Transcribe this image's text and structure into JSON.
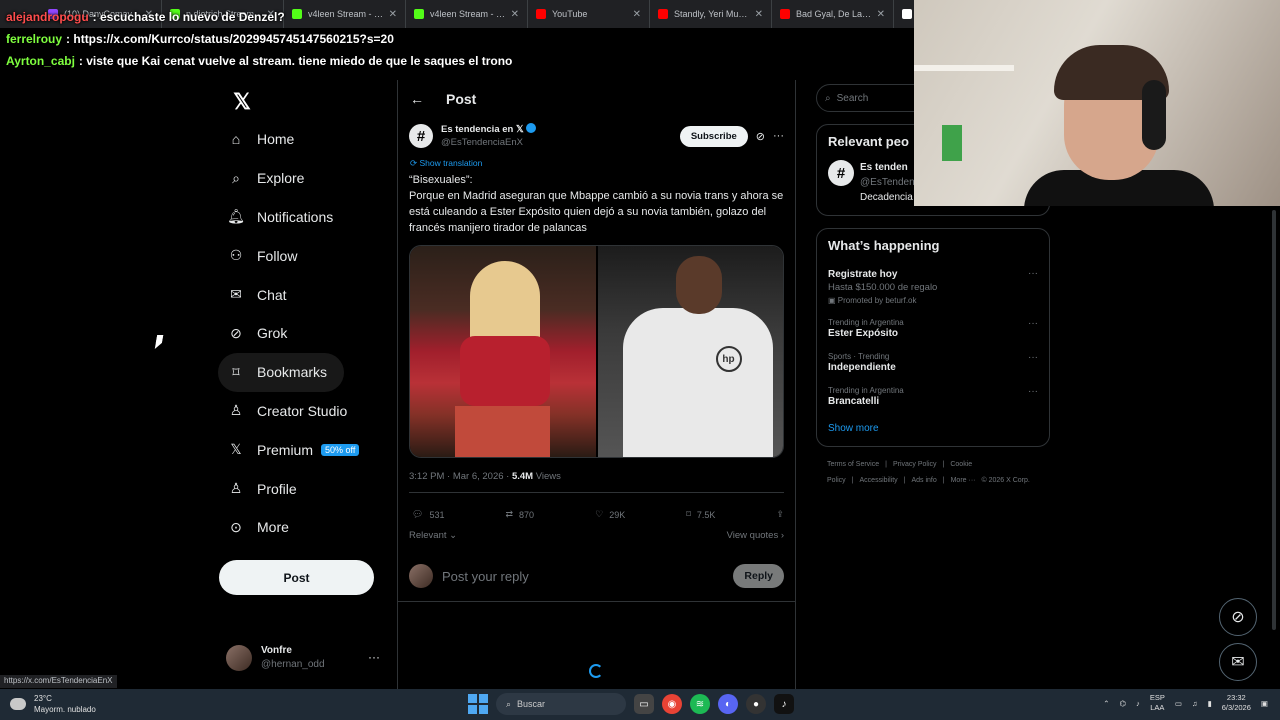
{
  "browser": {
    "tabs": [
      {
        "label": "(10) DanyComay",
        "color": "#9147ff"
      },
      {
        "label": "n.dietrich Stream",
        "color": "#53fc18"
      },
      {
        "label": "v4leen Stream - Watc",
        "color": "#53fc18"
      },
      {
        "label": "v4leen Stream - Watc",
        "color": "#53fc18"
      },
      {
        "label": "YouTube",
        "color": "#ff0000"
      },
      {
        "label": "Standly, Yeri Mua, Ou",
        "color": "#ff0000"
      },
      {
        "label": "Bad Gyal, De La Rose",
        "color": "#ff0000"
      },
      {
        "label": "",
        "color": "#ffffff"
      }
    ],
    "status_url": "https://x.com/EsTendenciaEnX"
  },
  "chat": [
    {
      "user": "alejandropogu",
      "user_color": "#ff4d4d",
      "message": ": escuchaste lo nuevo de Denzel?"
    },
    {
      "user": "ferrelrouy",
      "user_color": "#7fff3f",
      "message": ": https://x.com/Kurrco/status/2029945745147560215?s=20"
    },
    {
      "user": "Ayrton_cabj",
      "user_color": "#7fff3f",
      "message": ": viste que Kai cenat vuelve al stream. tiene miedo de que le saques el trono"
    }
  ],
  "nav": {
    "items": [
      {
        "label": "Home",
        "icon": "home-icon"
      },
      {
        "label": "Explore",
        "icon": "search-icon"
      },
      {
        "label": "Notifications",
        "icon": "bell-icon"
      },
      {
        "label": "Follow",
        "icon": "person-plus-icon"
      },
      {
        "label": "Chat",
        "icon": "envelope-icon"
      },
      {
        "label": "Grok",
        "icon": "grok-icon"
      },
      {
        "label": "Bookmarks",
        "icon": "bookmark-icon"
      },
      {
        "label": "Creator Studio",
        "icon": "creator-icon"
      },
      {
        "label": "Premium",
        "icon": "x-icon",
        "badge": "50% off"
      },
      {
        "label": "Profile",
        "icon": "person-icon"
      },
      {
        "label": "More",
        "icon": "more-circle-icon"
      }
    ],
    "post_button": "Post",
    "account": {
      "name": "Vonfre",
      "handle": "@hernan_odd"
    }
  },
  "post": {
    "header_title": "Post",
    "author_name": "Es tendencia en 𝕏",
    "author_handle": "@EsTendenciaEnX",
    "subscribe_label": "Subscribe",
    "show_translation": "Show translation",
    "text_line1": "“Bisexuales”:",
    "text_body": "Porque en Madrid aseguran que Mbappe cambió a su novia trans y ahora se está culeando a Ester Expósito quien dejó a su novia también, golazo del francés manijero tirador de palancas",
    "timestamp": "3:12 PM · Mar 6, 2026 · ",
    "views_count": "5.4M",
    "views_label": " Views",
    "stats": {
      "replies": "531",
      "reposts": "870",
      "likes": "29K",
      "bookmarks": "7.5K"
    },
    "sort_label": "Relevant ⌄",
    "view_quotes": "View quotes ›",
    "reply_placeholder": "Post your reply",
    "reply_button": "Reply"
  },
  "sidebar": {
    "search_placeholder": "Search",
    "relevant_title": "Relevant peo",
    "relevant_person": {
      "name": "Es tenden",
      "handle": "@EsTenden",
      "bio": "Decadencia"
    },
    "happening_title": "What’s happening",
    "trends": [
      {
        "context": "",
        "title": "Registrate hoy",
        "sub": "Hasta $150.000 de regalo",
        "promo": "Promoted by beturf.ok"
      },
      {
        "context": "Trending in Argentina",
        "title": "Ester Expósito",
        "sub": "",
        "promo": ""
      },
      {
        "context": "Sports · Trending",
        "title": "Independiente",
        "sub": "",
        "promo": ""
      },
      {
        "context": "Trending in Argentina",
        "title": "Brancatelli",
        "sub": "",
        "promo": ""
      }
    ],
    "show_more": "Show more",
    "footer_links": [
      "Terms of Service",
      "|",
      "Privacy Policy",
      "|",
      "Cookie Policy",
      "|",
      "Accessibility",
      "|",
      "Ads info",
      "|",
      "More ···",
      "© 2026 X Corp."
    ]
  },
  "taskbar": {
    "temp": "23°C",
    "weather": "Mayorm. nublado",
    "search": "Buscar",
    "lang_top": "ESP",
    "lang_bottom": "LAA",
    "time": "23:32",
    "date": "6/3/2026"
  }
}
